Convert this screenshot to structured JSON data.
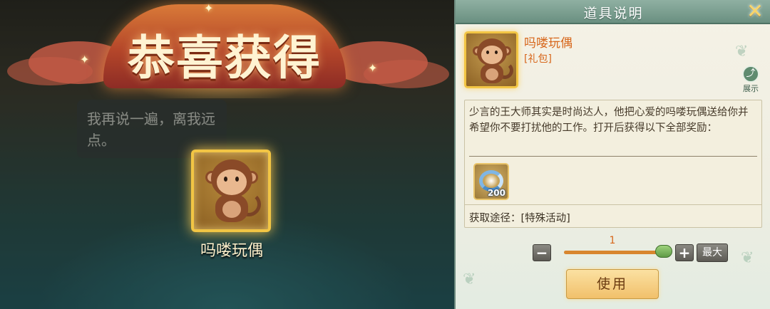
{
  "scene": {
    "banner_title": "恭喜获得",
    "dialog_text": "我再说一遍，离我远点。",
    "reward_name": "吗喽玩偶"
  },
  "panel": {
    "title": "道具说明",
    "close_icon": "close-icon",
    "item_name": "吗喽玩偶",
    "item_type": "[礼包]",
    "show_label": "展示",
    "description": "少言的王大师其实是时尚达人，他把心爱的吗喽玩偶送给你并希望你不要打扰他的工作。打开后获得以下全部奖励：",
    "reward_qty": "200",
    "source_text": "获取途径：[特殊活动]",
    "quantity": "1",
    "quantity_fraction": 1.0,
    "minus_label": "−",
    "plus_label": "+",
    "max_label": "最大",
    "use_label": "使用"
  },
  "colors": {
    "accent_orange": "#d7661a",
    "gold_frame": "#f2c544",
    "header_green": "#6a8f80"
  }
}
